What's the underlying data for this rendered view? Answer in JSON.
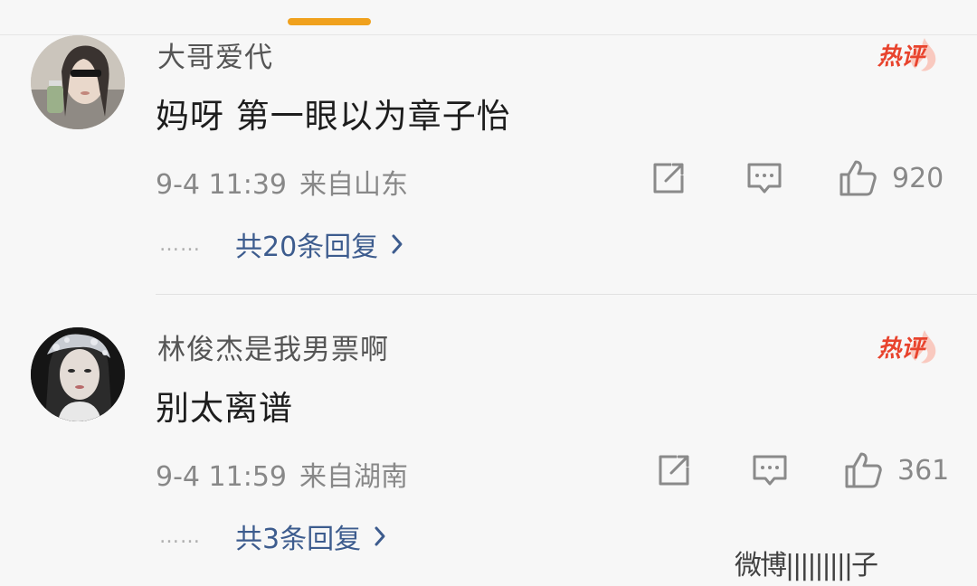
{
  "comments": [
    {
      "username": "大哥爱代",
      "badge": "热评",
      "text": "妈呀 第一眼以为章子怡",
      "time": "9-4 11:39",
      "location": "来自山东",
      "likes": "920",
      "replies_label": "共20条回复",
      "dots": "……"
    },
    {
      "username": "林俊杰是我男票啊",
      "badge": "热评",
      "text": "别太离谱",
      "time": "9-4 11:59",
      "location": "来自湖南",
      "likes": "361",
      "replies_label": "共3条回复",
      "dots": "……"
    }
  ],
  "watermark": "微博|||||||||子",
  "colors": {
    "accent": "#f0a11d",
    "hot": "#e8432d",
    "link": "#3d5c8e",
    "meta": "#888888"
  }
}
